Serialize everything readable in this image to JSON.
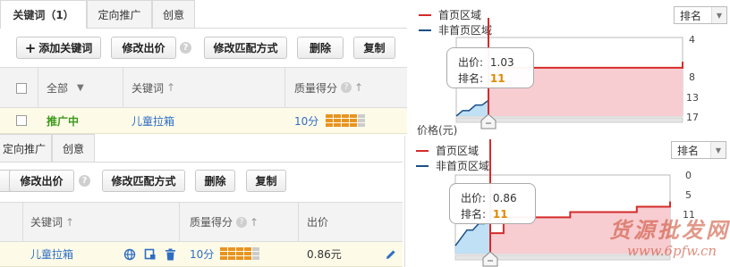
{
  "top": {
    "tabs": [
      "关键词（1）",
      "定向推广",
      "创意"
    ],
    "buttons": {
      "add": "添加关键词",
      "modify_bid": "修改出价",
      "match": "修改匹配方式",
      "delete": "删除",
      "copy": "复制"
    },
    "columns": {
      "all": "全部",
      "keyword": "关键词",
      "quality": "质量得分"
    },
    "row": {
      "status": "推广中",
      "keyword": "儿童拉箱",
      "quality": "10分"
    }
  },
  "bottom": {
    "tabs": [
      "定向推广",
      "创意"
    ],
    "buttons": {
      "modify_bid": "修改出价",
      "match": "修改匹配方式",
      "delete": "删除",
      "copy": "复制"
    },
    "columns": {
      "keyword": "关键词",
      "quality": "质量得分",
      "bid": "出价"
    },
    "row": {
      "keyword": "儿童拉箱",
      "quality": "10分",
      "bid": "0.86元"
    }
  },
  "chart_top": {
    "legend": {
      "home": "首页区域",
      "non_home": "非首页区域"
    },
    "select": "排名",
    "tooltip": {
      "bid_label": "出价:",
      "bid": "1.03",
      "rank_label": "排名:",
      "rank": "11"
    },
    "yticks": [
      "4",
      "8",
      "13",
      "17"
    ],
    "xlabel": "价格(元)"
  },
  "chart_bottom": {
    "legend": {
      "home": "首页区域",
      "non_home": "非首页区域"
    },
    "select": "排名",
    "tooltip": {
      "bid_label": "出价:",
      "bid": "0.86",
      "rank_label": "排名:",
      "rank": "11"
    },
    "yticks": [
      "0",
      "5",
      "11"
    ]
  },
  "watermark": {
    "title": "货源批发网",
    "url": "www.6pfw.cn"
  },
  "colors": {
    "home_line": "#d42b2b",
    "home_fill": "#f8cdd2",
    "non_home_line": "#1a4f86",
    "non_home_fill": "#bfe0f5",
    "bar_filled": "#e89420",
    "bar_empty": "#cccccc",
    "link": "#2e6dc4",
    "active_status": "#3a9a1a"
  },
  "chart_data": [
    {
      "type": "line",
      "series": [
        {
          "name": "首页区域",
          "x": [
            1.03,
            1.06,
            1.15,
            1.25,
            1.35,
            1.45,
            1.55,
            1.65
          ],
          "y": [
            11,
            9,
            9,
            9,
            9,
            9,
            9,
            8
          ]
        }
      ],
      "yticks": [
        "4",
        "8",
        "13",
        "17"
      ]
    },
    {
      "type": "line",
      "series": [
        {
          "name": "首页区域",
          "x": [
            0.86,
            0.9,
            1.0,
            1.1,
            1.2,
            1.3,
            1.4
          ],
          "y": [
            11,
            8,
            8,
            7,
            7,
            6,
            5
          ]
        }
      ],
      "yticks": [
        "0",
        "5",
        "11"
      ]
    }
  ]
}
